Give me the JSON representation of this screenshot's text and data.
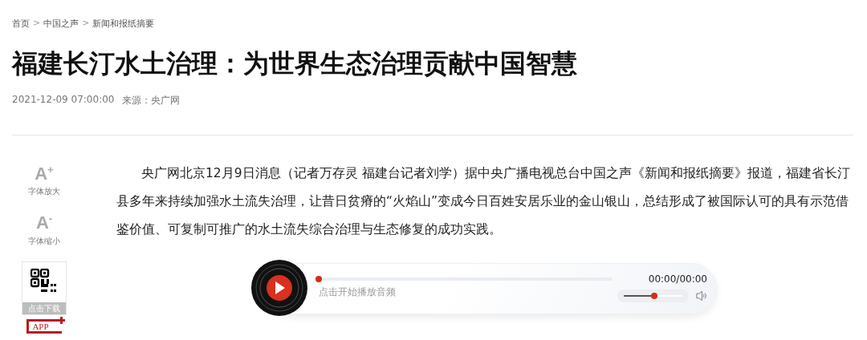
{
  "breadcrumb": [
    "首页",
    ">",
    "中国之声",
    ">",
    "新闻和报纸摘要"
  ],
  "title": "福建长汀水土治理：为世界生态治理贡献中国智慧",
  "meta": {
    "time": "2021-12-09 07:00:00",
    "source": "来源：央广网"
  },
  "tools": [
    {
      "kind": "font",
      "label": "字体放大",
      "glyph": "A",
      "sign": "+"
    },
    {
      "kind": "font",
      "label": "字体缩小",
      "glyph": "A",
      "sign": "-"
    },
    {
      "kind": "qr",
      "label": "点击下载",
      "badge": "APP"
    }
  ],
  "article": "央广网北京12月9日消息（记者万存灵 福建台记者刘学）据中央广播电视总台中国之声《新闻和报纸摘要》报道，福建省长汀县多年来持续加强水土流失治理，让昔日贫瘠的“火焰山”变成今日百姓安居乐业的金山银山，总结形成了被国际认可的具有示范借鉴价值、可复制可推广的水土流失综合治理与生态修复的成功实践。",
  "player": {
    "hint": "点击开始播放音频",
    "time": "00:00/00:00",
    "progress": {
      "level": 0
    },
    "volume": {
      "level": 0.52
    }
  }
}
